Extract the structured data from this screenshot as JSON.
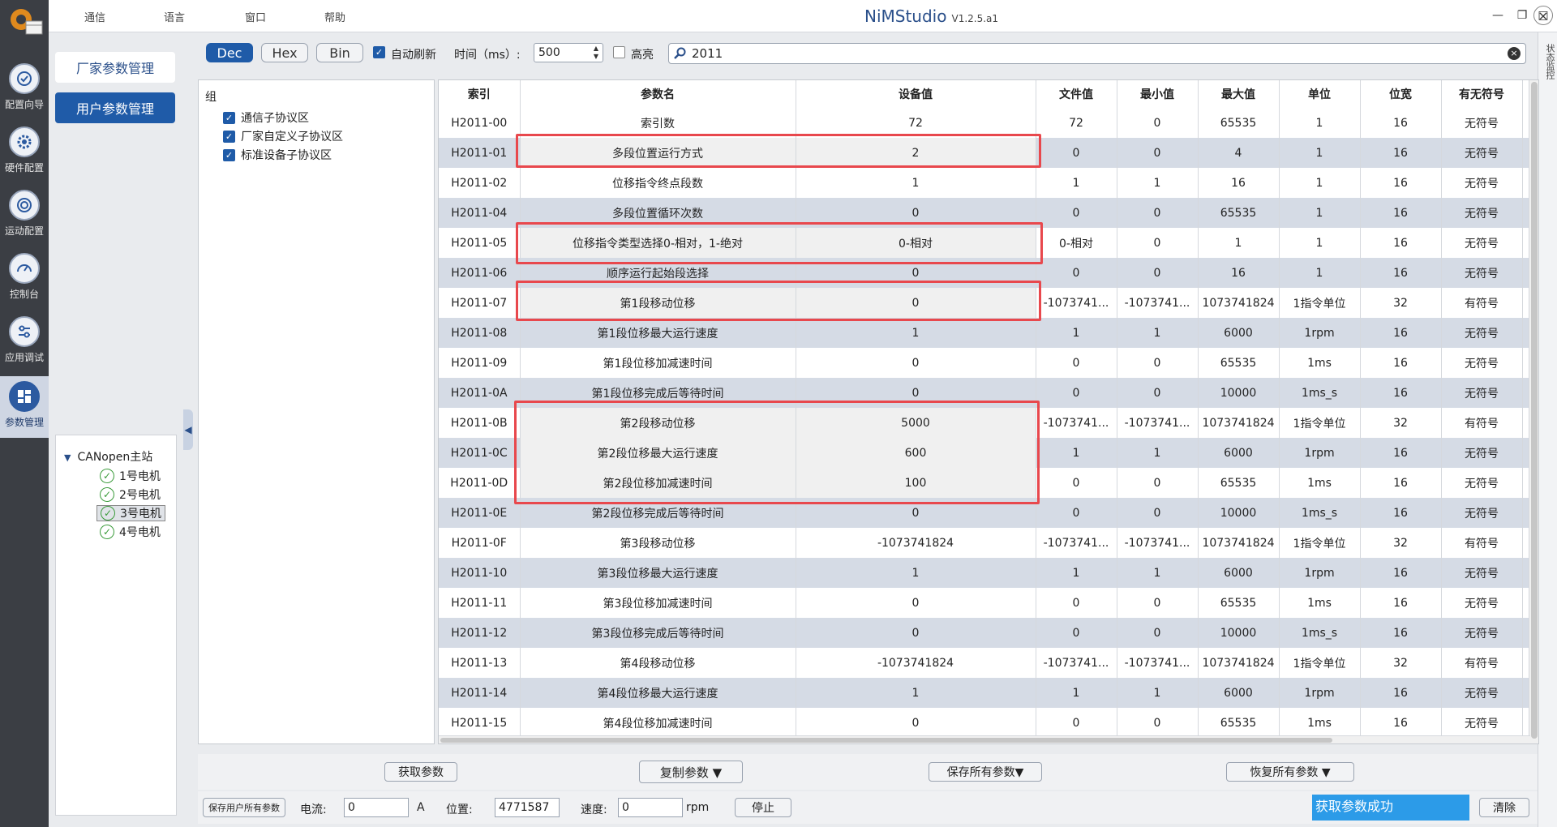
{
  "app": {
    "title": "NiMStudio",
    "version": "V1.2.5.a1"
  },
  "menu": [
    "通信",
    "语言",
    "窗口",
    "帮助"
  ],
  "nav": [
    {
      "label": "配置向导",
      "icon": "wizard-icon"
    },
    {
      "label": "硬件配置",
      "icon": "hardware-icon"
    },
    {
      "label": "运动配置",
      "icon": "motion-icon"
    },
    {
      "label": "控制台",
      "icon": "dashboard-icon"
    },
    {
      "label": "应用调试",
      "icon": "sliders-icon"
    },
    {
      "label": "参数管理",
      "icon": "params-icon"
    }
  ],
  "side": {
    "factory_btn": "厂家参数管理",
    "user_btn": "用户参数管理"
  },
  "tree": {
    "root": "CANopen主站",
    "items": [
      "1号电机",
      "2号电机",
      "3号电机",
      "4号电机"
    ]
  },
  "toolbar": {
    "dec": "Dec",
    "hex": "Hex",
    "bin": "Bin",
    "auto_refresh": "自动刷新",
    "interval_label": "时间（ms）:",
    "interval_value": "500",
    "highlight": "高亮",
    "search_value": "2011"
  },
  "groups": {
    "title": "组",
    "items": [
      "通信子协议区",
      "厂家自定义子协议区",
      "标准设备子协议区"
    ]
  },
  "table": {
    "headers": [
      "索引",
      "参数名",
      "设备值",
      "文件值",
      "最小值",
      "最大值",
      "单位",
      "位宽",
      "有无符号"
    ],
    "rows": [
      [
        "H2011-00",
        "索引数",
        "72",
        "72",
        "0",
        "65535",
        "1",
        "16",
        "无符号"
      ],
      [
        "H2011-01",
        "多段位置运行方式",
        "2",
        "0",
        "0",
        "4",
        "1",
        "16",
        "无符号"
      ],
      [
        "H2011-02",
        "位移指令终点段数",
        "1",
        "1",
        "1",
        "16",
        "1",
        "16",
        "无符号"
      ],
      [
        "H2011-04",
        "多段位置循环次数",
        "0",
        "0",
        "0",
        "65535",
        "1",
        "16",
        "无符号"
      ],
      [
        "H2011-05",
        "位移指令类型选择0-相对，1-绝对",
        "0-相对",
        "0-相对",
        "0",
        "1",
        "1",
        "16",
        "无符号"
      ],
      [
        "H2011-06",
        "顺序运行起始段选择",
        "0",
        "0",
        "0",
        "16",
        "1",
        "16",
        "无符号"
      ],
      [
        "H2011-07",
        "第1段移动位移",
        "0",
        "-1073741...",
        "-1073741...",
        "1073741824",
        "1指令单位",
        "32",
        "有符号"
      ],
      [
        "H2011-08",
        "第1段位移最大运行速度",
        "1",
        "1",
        "1",
        "6000",
        "1rpm",
        "16",
        "无符号"
      ],
      [
        "H2011-09",
        "第1段位移加减速时间",
        "0",
        "0",
        "0",
        "65535",
        "1ms",
        "16",
        "无符号"
      ],
      [
        "H2011-0A",
        "第1段位移完成后等待时间",
        "0",
        "0",
        "0",
        "10000",
        "1ms_s",
        "16",
        "无符号"
      ],
      [
        "H2011-0B",
        "第2段移动位移",
        "5000",
        "-1073741...",
        "-1073741...",
        "1073741824",
        "1指令单位",
        "32",
        "有符号"
      ],
      [
        "H2011-0C",
        "第2段位移最大运行速度",
        "600",
        "1",
        "1",
        "6000",
        "1rpm",
        "16",
        "无符号"
      ],
      [
        "H2011-0D",
        "第2段位移加减速时间",
        "100",
        "0",
        "0",
        "65535",
        "1ms",
        "16",
        "无符号"
      ],
      [
        "H2011-0E",
        "第2段位移完成后等待时间",
        "0",
        "0",
        "0",
        "10000",
        "1ms_s",
        "16",
        "无符号"
      ],
      [
        "H2011-0F",
        "第3段移动位移",
        "-1073741824",
        "-1073741...",
        "-1073741...",
        "1073741824",
        "1指令单位",
        "32",
        "有符号"
      ],
      [
        "H2011-10",
        "第3段位移最大运行速度",
        "1",
        "1",
        "1",
        "6000",
        "1rpm",
        "16",
        "无符号"
      ],
      [
        "H2011-11",
        "第3段位移加减速时间",
        "0",
        "0",
        "0",
        "65535",
        "1ms",
        "16",
        "无符号"
      ],
      [
        "H2011-12",
        "第3段位移完成后等待时间",
        "0",
        "0",
        "0",
        "10000",
        "1ms_s",
        "16",
        "无符号"
      ],
      [
        "H2011-13",
        "第4段移动位移",
        "-1073741824",
        "-1073741...",
        "-1073741...",
        "1073741824",
        "1指令单位",
        "32",
        "有符号"
      ],
      [
        "H2011-14",
        "第4段位移最大运行速度",
        "1",
        "1",
        "1",
        "6000",
        "1rpm",
        "16",
        "无符号"
      ],
      [
        "H2011-15",
        "第4段位移加减速时间",
        "0",
        "0",
        "0",
        "65535",
        "1ms",
        "16",
        "无符号"
      ]
    ]
  },
  "bottom": {
    "get_params": "获取参数",
    "copy_params": "复制参数 ▼",
    "save_all": "保存所有参数▼",
    "restore_all": "恢复所有参数  ▼"
  },
  "status": {
    "save_user": "保存用户所有参数",
    "current_label": "电流:",
    "current_value": "0",
    "current_unit": "A",
    "position_label": "位置:",
    "position_value": "4771587",
    "speed_label": "速度:",
    "speed_value": "0",
    "speed_unit": "rpm",
    "stop": "停止",
    "message": "获取参数成功",
    "clear": "清除",
    "monitor": "状态监控"
  },
  "colors": {
    "accent": "#1f5ba8",
    "annotation": "#e8484d",
    "status_msg": "#2c9be8",
    "row_alt": "#d5dbe5"
  }
}
